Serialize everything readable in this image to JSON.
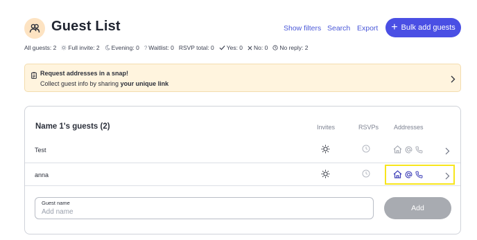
{
  "header": {
    "title": "Guest List",
    "show_filters": "Show filters",
    "search": "Search",
    "export": "Export",
    "bulk_add": "Bulk add guests",
    "logo_icon": "people-icon"
  },
  "stats": {
    "all_guests": "All guests: 2",
    "full_invite": "Full invite: 2",
    "evening": "Evening: 0",
    "waitlist": "Waitlist: 0",
    "rsvp_total": "RSVP total: 0",
    "yes": "Yes: 0",
    "no": "No: 0",
    "no_reply": "No reply: 2"
  },
  "banner": {
    "title": "Request addresses in a snap!",
    "text": "Collect guest info by sharing",
    "link": "your unique link"
  },
  "guests": {
    "group_title": "Name 1's guests (2)",
    "columns": {
      "invites": "Invites",
      "rsvps": "RSVPs",
      "addresses": "Addresses"
    },
    "rows": [
      {
        "name": "Test",
        "invite_icon": "sun-icon",
        "rsvp_icon": "clock-icon",
        "addresses_active": false
      },
      {
        "name": "anna",
        "invite_icon": "sun-icon",
        "rsvp_icon": "clock-icon",
        "addresses_active": true
      }
    ]
  },
  "add_guest": {
    "label": "Guest name",
    "placeholder": "Add name",
    "value": "",
    "button": "Add"
  },
  "colors": {
    "accent": "#4a4fe4",
    "banner_bg": "#fff4de",
    "highlight": "#f7e51c",
    "disabled_button": "#a8abb1"
  }
}
